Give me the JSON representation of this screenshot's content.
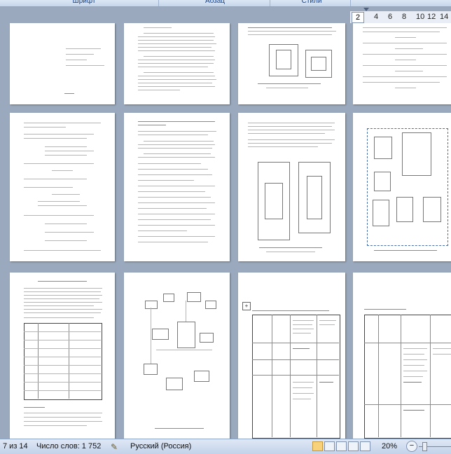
{
  "ribbon": {
    "groups": [
      "Шрифт",
      "Абзац",
      "Стили"
    ]
  },
  "ruler": {
    "selected": "2",
    "ticks": [
      "2",
      "4",
      "6",
      "8",
      "10",
      "12",
      "14"
    ]
  },
  "status": {
    "page": "7 из 14",
    "words": "Число слов: 1 752",
    "language": "Русский (Россия)",
    "zoom": "20%"
  },
  "colors": {
    "workspace": "#9aa9bd",
    "ribbon": "#c6d6ec"
  }
}
